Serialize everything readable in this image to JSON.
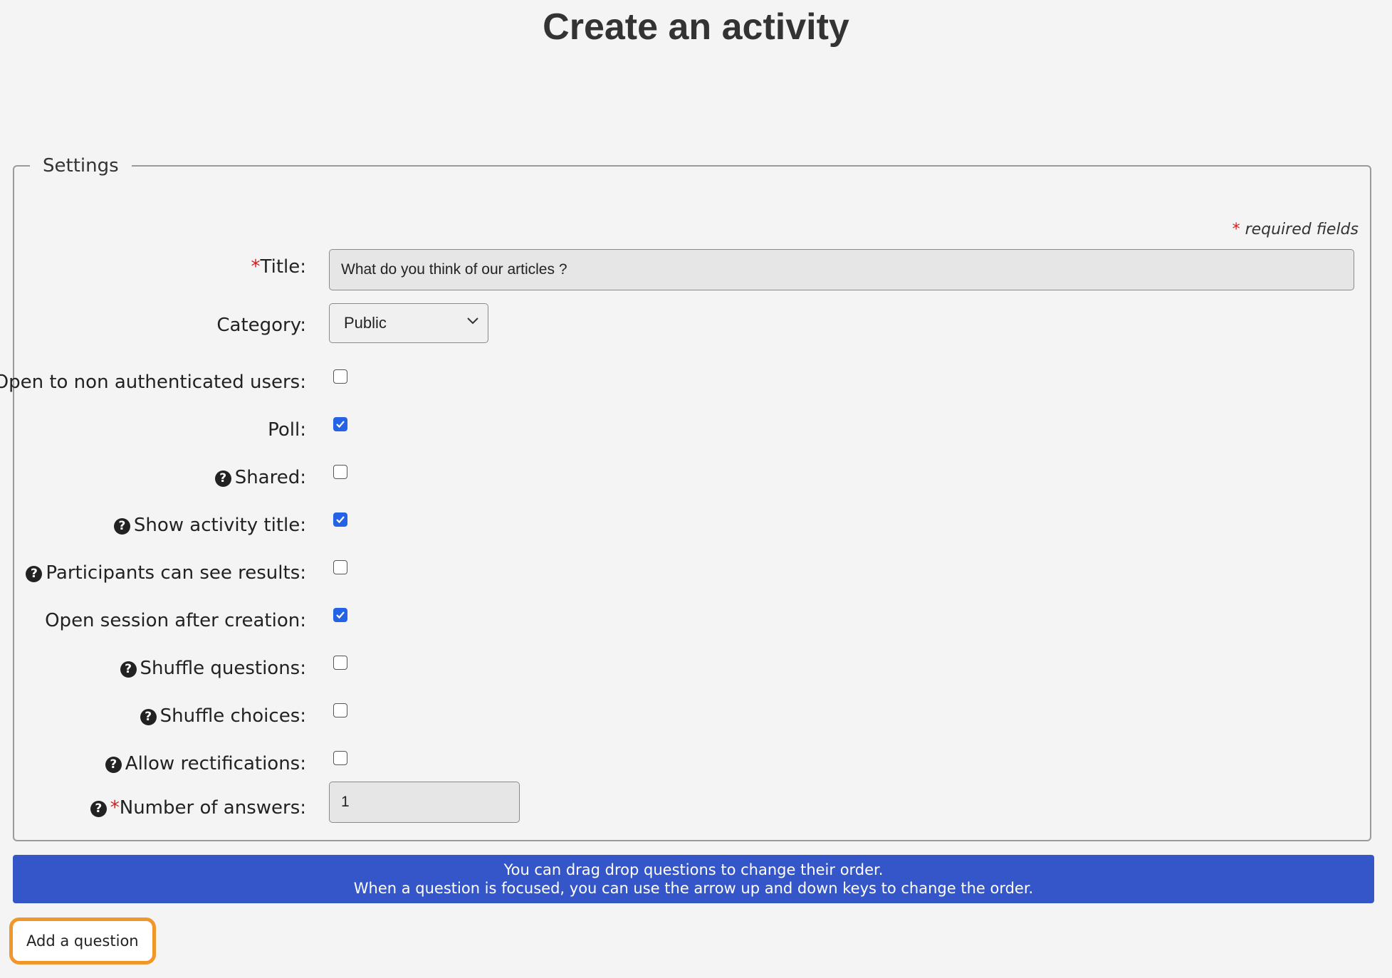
{
  "page": {
    "title": "Create an activity"
  },
  "settings": {
    "legend": "Settings",
    "required_note": {
      "star": "*",
      "text": "required fields"
    },
    "title_field": {
      "star": "*",
      "label": "Title:",
      "value": "What do you think of our articles ?"
    },
    "category": {
      "label": "Category:",
      "selected": "Public"
    },
    "options": [
      {
        "label": "Open to non authenticated users:",
        "help": false,
        "checked": false
      },
      {
        "label": "Poll:",
        "help": false,
        "checked": true
      },
      {
        "label": "Shared:",
        "help": true,
        "checked": false
      },
      {
        "label": "Show activity title:",
        "help": true,
        "checked": true
      },
      {
        "label": "Participants can see results:",
        "help": true,
        "checked": false
      },
      {
        "label": "Open session after creation:",
        "help": false,
        "checked": true
      },
      {
        "label": "Shuffle questions:",
        "help": true,
        "checked": false
      },
      {
        "label": "Shuffle choices:",
        "help": true,
        "checked": false
      },
      {
        "label": "Allow rectifications:",
        "help": true,
        "checked": false
      }
    ],
    "number_of_answers": {
      "star": "*",
      "label": "Number of answers:",
      "value": "1"
    }
  },
  "info_banner": {
    "line1": "You can drag drop questions to change their order.",
    "line2": "When a question is focused, you can use the arrow up and down keys to change the order."
  },
  "add_question_button": {
    "label": "Add a question"
  },
  "colors": {
    "accent": "#2563e6",
    "banner": "#3456c8",
    "highlight": "#f0962a",
    "required": "#d02020"
  },
  "icons": {
    "help": "question-circle-icon",
    "select_arrow": "chevron-down-icon",
    "check": "checkmark-icon"
  }
}
